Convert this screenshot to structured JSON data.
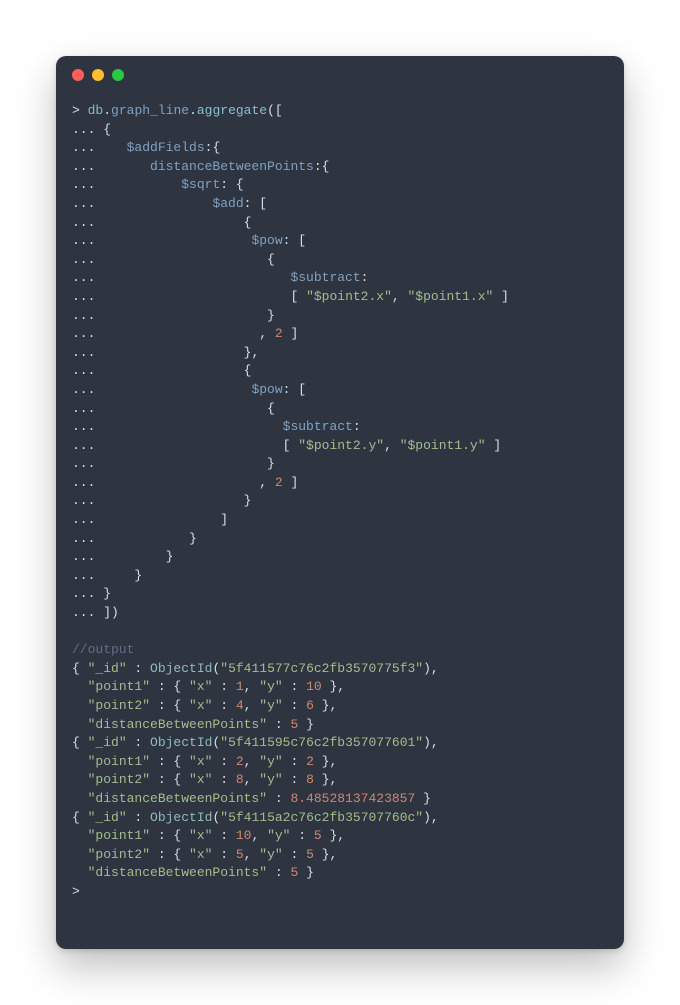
{
  "code": {
    "prompt": ">",
    "cont": "...",
    "db": "db",
    "collection": "graph_line",
    "method": "aggregate",
    "addFields": "$addFields",
    "distanceBetweenPoints": "distanceBetweenPoints",
    "sqrt": "$sqrt",
    "add": "$add",
    "pow": "$pow",
    "subtract": "$subtract",
    "p2x": "\"$point2.x\"",
    "p1x": "\"$point1.x\"",
    "p2y": "\"$point2.y\"",
    "p1y": "\"$point1.y\"",
    "two": "2"
  },
  "output": {
    "comment": "//output",
    "objectId": "ObjectId",
    "rows": [
      {
        "_id": "\"5f411577c76c2fb3570775f3\"",
        "point1": {
          "x": "1",
          "y": "10"
        },
        "point2": {
          "x": "4",
          "y": "6"
        },
        "distance": "5"
      },
      {
        "_id": "\"5f411595c76c2fb357077601\"",
        "point1": {
          "x": "2",
          "y": "2"
        },
        "point2": {
          "x": "8",
          "y": "8"
        },
        "distance": "8.48528137423857"
      },
      {
        "_id": "\"5f4115a2c76c2fb35707760c\"",
        "point1": {
          "x": "10",
          "y": "5"
        },
        "point2": {
          "x": "5",
          "y": "5"
        },
        "distance": "5"
      }
    ],
    "keys": {
      "_id": "\"_id\"",
      "point1": "\"point1\"",
      "point2": "\"point2\"",
      "x": "\"x\"",
      "y": "\"y\"",
      "distance": "\"distanceBetweenPoints\""
    }
  }
}
